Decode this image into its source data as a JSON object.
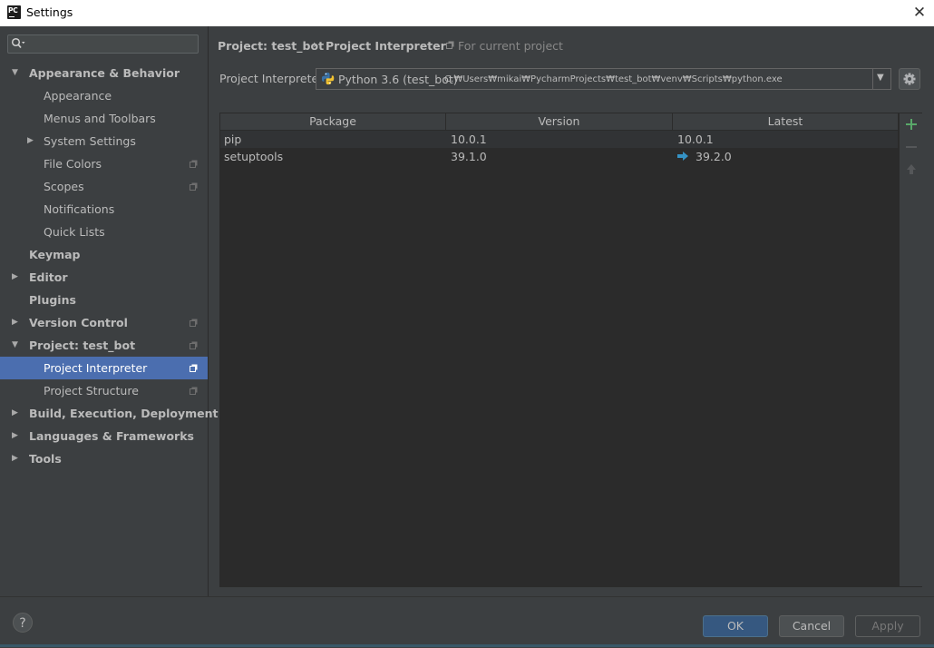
{
  "window": {
    "title": "Settings",
    "app_icon_text": "PC"
  },
  "sidebar": {
    "search": {
      "value": "",
      "placeholder": ""
    },
    "items": [
      {
        "label": "Appearance & Behavior",
        "level": 0,
        "expanded": true,
        "bold": true,
        "has_arrow": true
      },
      {
        "label": "Appearance",
        "level": 1
      },
      {
        "label": "Menus and Toolbars",
        "level": 1
      },
      {
        "label": "System Settings",
        "level": 1,
        "has_arrow": true,
        "expanded": false
      },
      {
        "label": "File Colors",
        "level": 1,
        "project_icon": true
      },
      {
        "label": "Scopes",
        "level": 1,
        "project_icon": true
      },
      {
        "label": "Notifications",
        "level": 1
      },
      {
        "label": "Quick Lists",
        "level": 1
      },
      {
        "label": "Keymap",
        "level": 0,
        "bold": true
      },
      {
        "label": "Editor",
        "level": 0,
        "bold": true,
        "has_arrow": true,
        "expanded": false
      },
      {
        "label": "Plugins",
        "level": 0,
        "bold": true
      },
      {
        "label": "Version Control",
        "level": 0,
        "bold": true,
        "has_arrow": true,
        "expanded": false,
        "project_icon": true
      },
      {
        "label": "Project: test_bot",
        "level": 0,
        "bold": true,
        "has_arrow": true,
        "expanded": true,
        "project_icon": true
      },
      {
        "label": "Project Interpreter",
        "level": 1,
        "selected": true,
        "project_icon": true
      },
      {
        "label": "Project Structure",
        "level": 1,
        "project_icon": true
      },
      {
        "label": "Build, Execution, Deployment",
        "level": 0,
        "bold": true,
        "has_arrow": true,
        "expanded": false
      },
      {
        "label": "Languages & Frameworks",
        "level": 0,
        "bold": true,
        "has_arrow": true,
        "expanded": false
      },
      {
        "label": "Tools",
        "level": 0,
        "bold": true,
        "has_arrow": true,
        "expanded": false
      }
    ]
  },
  "breadcrumb": {
    "project": "Project: test_bot",
    "separator": "›",
    "page": "Project Interpreter",
    "note": "For current project"
  },
  "interpreter": {
    "label": "Project Interpreter:",
    "name": "Python 3.6 (test_bot)",
    "path": "C:₩Users₩mikai₩PycharmProjects₩test_bot₩venv₩Scripts₩python.exe"
  },
  "packages": {
    "columns": [
      "Package",
      "Version",
      "Latest"
    ],
    "rows": [
      {
        "package": "pip",
        "version": "10.0.1",
        "latest": "10.0.1",
        "upgrade": false
      },
      {
        "package": "setuptools",
        "version": "39.1.0",
        "latest": "39.2.0",
        "upgrade": true
      }
    ]
  },
  "buttons": {
    "help": "?",
    "ok": "OK",
    "cancel": "Cancel",
    "apply": "Apply"
  },
  "colors": {
    "selection": "#4b6eaf",
    "accent_add": "#59a869",
    "upgrade_arrow": "#3592c4",
    "ok_button": "#365880"
  }
}
